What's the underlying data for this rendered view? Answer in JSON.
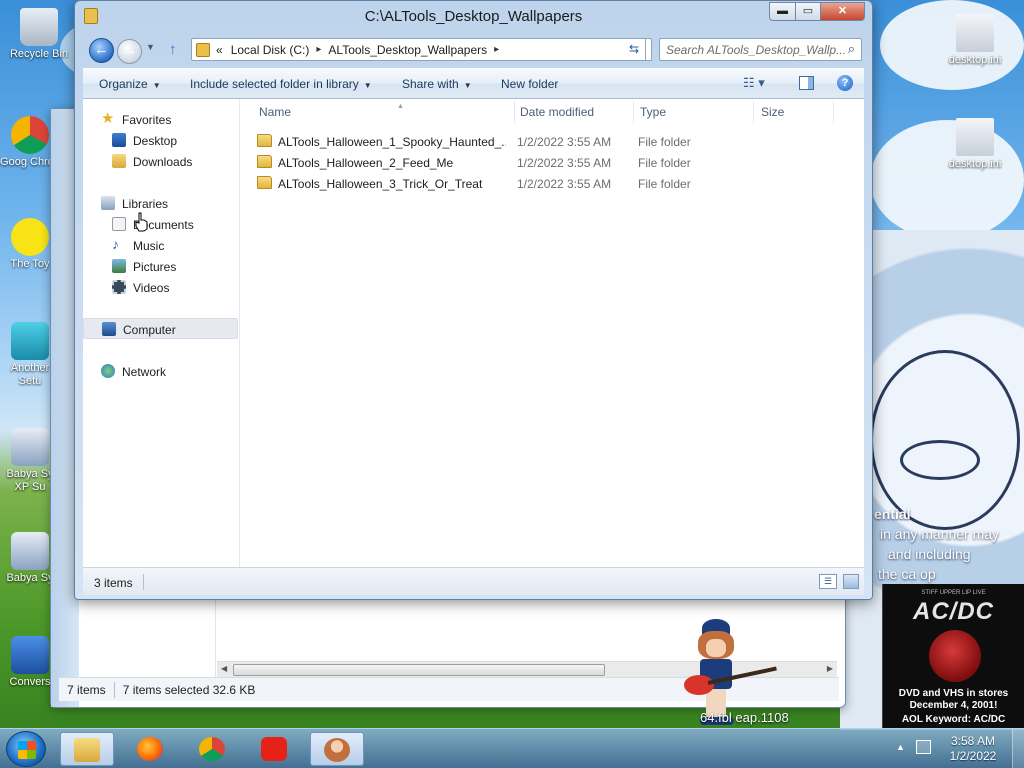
{
  "window": {
    "title": "C:\\ALTools_Desktop_Wallpapers",
    "min_label": "▬",
    "max_label": "▭",
    "close_label": "✕"
  },
  "address": {
    "prefix": "«",
    "segments": [
      "Local Disk (C:)",
      "ALTools_Desktop_Wallpapers"
    ],
    "chevron": "▸"
  },
  "search": {
    "placeholder": "Search ALTools_Desktop_Wallp...",
    "icon": "search-icon"
  },
  "commands": {
    "organize": "Organize",
    "include": "Include selected folder in library",
    "share": "Share with",
    "new_folder": "New folder"
  },
  "nav": {
    "favorites": "Favorites",
    "desktop": "Desktop",
    "downloads": "Downloads",
    "libraries": "Libraries",
    "documents": "Documents",
    "music": "Music",
    "pictures": "Pictures",
    "videos": "Videos",
    "computer": "Computer",
    "network": "Network"
  },
  "columns": {
    "name": "Name",
    "date": "Date modified",
    "type": "Type",
    "size": "Size"
  },
  "files": [
    {
      "name": "ALTools_Halloween_1_Spooky_Haunted_...",
      "date": "1/2/2022 3:55 AM",
      "type": "File folder"
    },
    {
      "name": "ALTools_Halloween_2_Feed_Me",
      "date": "1/2/2022 3:55 AM",
      "type": "File folder"
    },
    {
      "name": "ALTools_Halloween_3_Trick_Or_Treat",
      "date": "1/2/2022 3:55 AM",
      "type": "File folder"
    }
  ],
  "status": {
    "count": "3 items"
  },
  "background_window": {
    "items": "7 items",
    "selected": "7 items selected  32.6 KB"
  },
  "desktop_icons": {
    "recycle": "Recycle Bin",
    "chrome": "Goog Chron",
    "toy": "The Toy",
    "another": "Another Setu",
    "babya_xp": "Babya Sy XP Su",
    "babya": "Babya Sy",
    "convers": "Convers",
    "desktop_ini_1": "desktop.ini",
    "desktop_ini_2": "desktop.ini"
  },
  "background_text": {
    "line1": "ential",
    "line2": "in any manner may",
    "line3": "and including",
    "line4": "the ca   op"
  },
  "promo": {
    "top": "STIFF UPPER LIP LIVE",
    "logo": "AC/DC",
    "line1": "DVD and VHS in stores",
    "line2": "December 4, 2001!",
    "line3": "AOL Keyword: AC/DC"
  },
  "filename_text": "64.fbl  eap.1108",
  "clock": {
    "time": "3:58 AM",
    "date": "1/2/2022"
  },
  "colors": {
    "accent": "#2a6fc8",
    "folder": "#e9c04d",
    "close": "#c7462f"
  }
}
